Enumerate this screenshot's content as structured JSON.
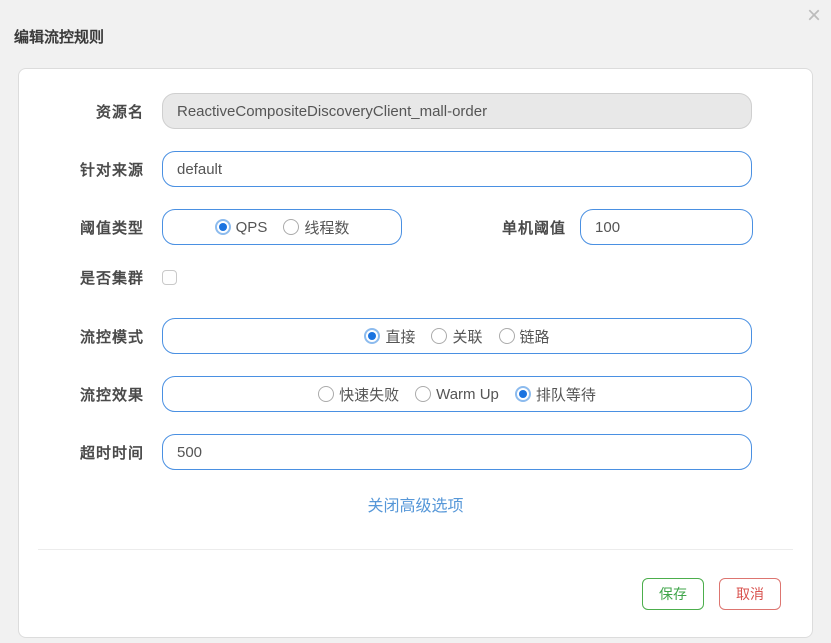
{
  "dialog": {
    "title": "编辑流控规则",
    "close_icon": "×"
  },
  "form": {
    "resource": {
      "label": "资源名",
      "value": "ReactiveCompositeDiscoveryClient_mall-order",
      "disabled": true
    },
    "limit_app": {
      "label": "针对来源",
      "value": "default"
    },
    "grade": {
      "label": "阈值类型",
      "options": [
        {
          "label": "QPS",
          "selected": true
        },
        {
          "label": "线程数",
          "selected": false
        }
      ]
    },
    "count": {
      "label": "单机阈值",
      "value": "100"
    },
    "cluster": {
      "label": "是否集群",
      "checked": false
    },
    "strategy": {
      "label": "流控模式",
      "options": [
        {
          "label": "直接",
          "selected": true
        },
        {
          "label": "关联",
          "selected": false
        },
        {
          "label": "链路",
          "selected": false
        }
      ]
    },
    "behavior": {
      "label": "流控效果",
      "options": [
        {
          "label": "快速失败",
          "selected": false
        },
        {
          "label": "Warm Up",
          "selected": false
        },
        {
          "label": "排队等待",
          "selected": true
        }
      ]
    },
    "timeout": {
      "label": "超时时间",
      "value": "500"
    },
    "advanced_toggle_label": "关闭高级选项"
  },
  "footer": {
    "save_label": "保存",
    "cancel_label": "取消"
  },
  "colors": {
    "accent_blue": "#4a90e2",
    "radio_selected": "#1a73e0",
    "link_blue": "#5697d8",
    "save_green": "#4cae4c",
    "cancel_red": "#d9534f",
    "panel_border": "#dcdcdc",
    "disabled_bg": "#e8e8e8",
    "backdrop": "#f1f1f1"
  }
}
